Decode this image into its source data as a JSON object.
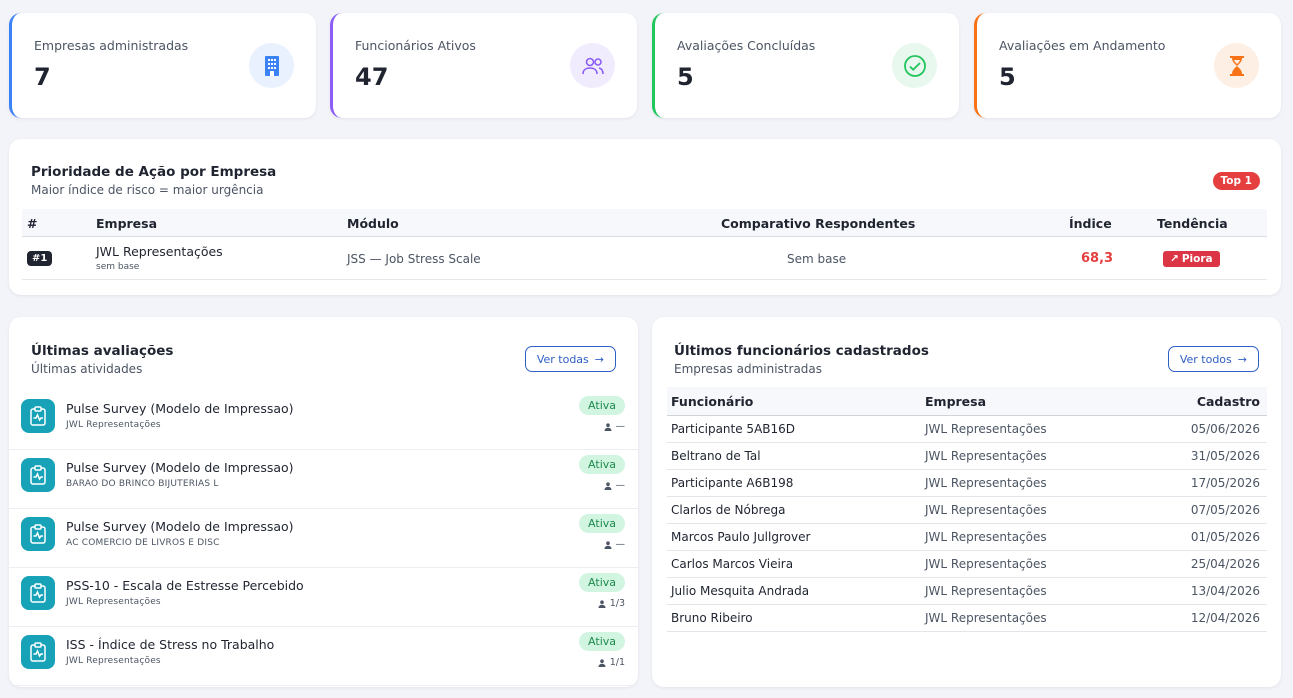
{
  "stats": [
    {
      "label": "Empresas administradas",
      "value": "7",
      "color": "#3b82f6",
      "icon": "building-icon"
    },
    {
      "label": "Funcionários Ativos",
      "value": "47",
      "color": "#8b5cf6",
      "icon": "users-icon"
    },
    {
      "label": "Avaliações Concluídas",
      "value": "5",
      "color": "#22c55e",
      "icon": "check-circle-icon"
    },
    {
      "label": "Avaliações em Andamento",
      "value": "5",
      "color": "#f97316",
      "icon": "hourglass-icon"
    }
  ],
  "priority": {
    "title": "Prioridade de Ação por Empresa",
    "subtitle": "Maior índice de risco = maior urgência",
    "badge": "Top 1",
    "headers": {
      "rank": "#",
      "empresa": "Empresa",
      "modulo": "Módulo",
      "comparativo": "Comparativo Respondentes",
      "indice": "Índice",
      "tendencia": "Tendência"
    },
    "rows": [
      {
        "rank": "#1",
        "empresa": "JWL Representações",
        "empresa_sub": "sem base",
        "modulo": "JSS — Job Stress Scale",
        "comparativo": "Sem base",
        "indice": "68,3",
        "tendencia": "Piora",
        "tendencia_icon": "↗"
      }
    ]
  },
  "last_evaluations": {
    "title": "Últimas avaliações",
    "subtitle": "Últimas atividades",
    "button": "Ver todas",
    "items": [
      {
        "title": "Pulse Survey (Modelo de Impressao)",
        "company": "JWL Representações",
        "status": "Ativa",
        "count": "—"
      },
      {
        "title": "Pulse Survey (Modelo de Impressao)",
        "company": "BARAO DO BRINCO BIJUTERIAS L",
        "status": "Ativa",
        "count": "—"
      },
      {
        "title": "Pulse Survey (Modelo de Impressao)",
        "company": "AC COMERCIO DE LIVROS E DISC",
        "status": "Ativa",
        "count": "—"
      },
      {
        "title": "PSS-10 - Escala de Estresse Percebido",
        "company": "JWL Representações",
        "status": "Ativa",
        "count": "1/3"
      },
      {
        "title": "ISS - Índice de Stress no Trabalho",
        "company": "JWL Representações",
        "status": "Ativa",
        "count": "1/1"
      }
    ]
  },
  "last_employees": {
    "title": "Últimos funcionários cadastrados",
    "subtitle": "Empresas administradas",
    "button": "Ver todos",
    "headers": {
      "name": "Funcionário",
      "company": "Empresa",
      "date": "Cadastro"
    },
    "rows": [
      {
        "name": "Participante 5AB16D",
        "company": "JWL Representações",
        "date": "05/06/2026"
      },
      {
        "name": "Beltrano de Tal",
        "company": "JWL Representações",
        "date": "31/05/2026"
      },
      {
        "name": "Participante A6B198",
        "company": "JWL Representações",
        "date": "17/05/2026"
      },
      {
        "name": "Clarlos de Nóbrega",
        "company": "JWL Representações",
        "date": "07/05/2026"
      },
      {
        "name": "Marcos Paulo Jullgrover",
        "company": "JWL Representações",
        "date": "01/05/2026"
      },
      {
        "name": "Carlos Marcos Vieira",
        "company": "JWL Representações",
        "date": "25/04/2026"
      },
      {
        "name": "Julio Mesquita Andrada",
        "company": "JWL Representações",
        "date": "13/04/2026"
      },
      {
        "name": "Bruno Ribeiro",
        "company": "JWL Representações",
        "date": "12/04/2026"
      }
    ]
  }
}
